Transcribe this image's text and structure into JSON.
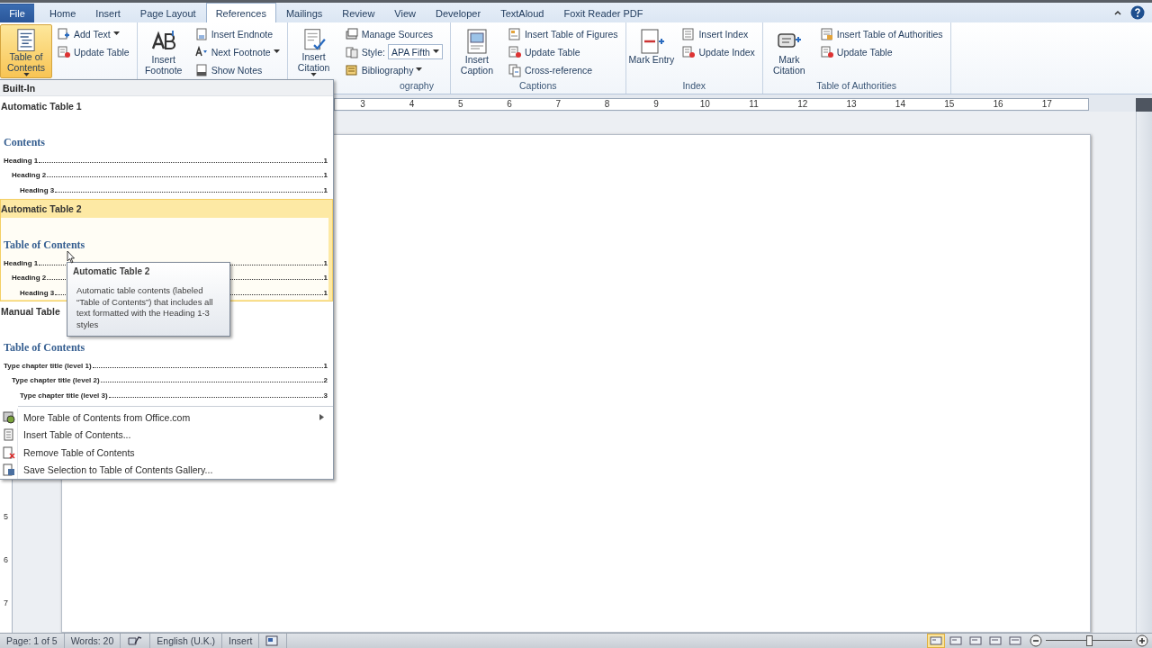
{
  "tabs": [
    {
      "label": "File",
      "kind": "file",
      "selected": false
    },
    {
      "label": "Home",
      "selected": false
    },
    {
      "label": "Insert",
      "selected": false
    },
    {
      "label": "Page Layout",
      "selected": false
    },
    {
      "label": "References",
      "selected": true
    },
    {
      "label": "Mailings",
      "selected": false
    },
    {
      "label": "Review",
      "selected": false
    },
    {
      "label": "View",
      "selected": false
    },
    {
      "label": "Developer",
      "selected": false
    },
    {
      "label": "TextAloud",
      "selected": false
    },
    {
      "label": "Foxit Reader PDF",
      "selected": false
    }
  ],
  "ribbon_groups": [
    {
      "large": {
        "label": "Table of Contents",
        "dropdown": true,
        "expanded": true
      },
      "small": [
        {
          "label": "Add Text",
          "dropdown": true
        },
        {
          "label": "Update Table"
        }
      ]
    },
    {
      "large": {
        "label": "Insert Footnote",
        "expanded": false
      },
      "small": [
        {
          "label": "Insert Endnote"
        },
        {
          "label": "Next Footnote",
          "dropdown": true
        },
        {
          "label": "Show Notes"
        }
      ]
    },
    {
      "label": "ography",
      "large": {
        "label": "Insert Citation",
        "dropdown": true,
        "expanded": false
      },
      "small": [
        {
          "label": "Manage Sources"
        },
        {
          "label": "Style:",
          "kind": "combo",
          "value": "APA Fifth"
        },
        {
          "label": "Bibliography",
          "dropdown": true
        }
      ]
    },
    {
      "label": "Captions",
      "large": {
        "label": "Insert Caption",
        "expanded": false
      },
      "small": [
        {
          "label": "Insert Table of Figures"
        },
        {
          "label": "Update Table"
        },
        {
          "label": "Cross-reference"
        }
      ]
    },
    {
      "label": "Index",
      "large": {
        "label": "Mark Entry",
        "expanded": false
      },
      "small": [
        {
          "label": "Insert Index"
        },
        {
          "label": "Update Index"
        }
      ]
    },
    {
      "label": "Table of Authorities",
      "large": {
        "label": "Mark Citation",
        "expanded": false
      },
      "small": [
        {
          "label": "Insert Table of Authorities"
        },
        {
          "label": "Update Table"
        }
      ]
    }
  ],
  "ruler_numbers": [
    "3",
    "4",
    "5",
    "6",
    "7",
    "8",
    "9",
    "10",
    "11",
    "12",
    "13",
    "14",
    "15",
    "16",
    "17"
  ],
  "vertical_ruler_numbers": [
    "5",
    "6",
    "7"
  ],
  "toc_gallery": {
    "section": "Built-In",
    "items": [
      {
        "title": "Automatic Table 1",
        "selected": false,
        "heading": "Contents",
        "entries": [
          {
            "text": "Heading 1",
            "page": "1",
            "children": [
              {
                "text": "Heading 2",
                "page": "1",
                "children": [
                  {
                    "text": "Heading 3",
                    "page": "1"
                  }
                ]
              }
            ]
          }
        ]
      },
      {
        "title": "Automatic Table 2",
        "selected": true,
        "heading": "Table of Contents",
        "entries": [
          {
            "text": "Heading 1",
            "page": "1",
            "children": [
              {
                "text": "Heading 2",
                "page": "1",
                "children": [
                  {
                    "text": "Heading 3",
                    "page": "1"
                  }
                ]
              }
            ]
          }
        ]
      },
      {
        "title": "Manual Table",
        "selected": false,
        "heading": "Table of Contents",
        "entries": [
          {
            "text": "Type chapter title (level 1)",
            "page": "1",
            "children": [
              {
                "text": "Type chapter title (level 2)",
                "page": "2",
                "children": [
                  {
                    "text": "Type chapter title (level 3)",
                    "page": "3"
                  }
                ]
              }
            ]
          }
        ]
      }
    ],
    "commands": [
      {
        "label": "More Table of Contents from Office.com",
        "submenu": true
      },
      {
        "label": "Insert Table of Contents..."
      },
      {
        "label": "Remove Table of Contents"
      },
      {
        "label": "Save Selection to Table of Contents Gallery..."
      }
    ]
  },
  "tooltip": {
    "title": "Automatic Table 2",
    "text": "Automatic table contents (labeled “Table of Contents”) that includes all text formatted with the Heading 1-3 styles"
  },
  "status_bar": {
    "items": [
      {
        "kind": "text",
        "text": "Page: 1 of 5"
      },
      {
        "kind": "text",
        "text": "Words: 20"
      },
      {
        "kind": "proofing"
      },
      {
        "kind": "text",
        "text": "English (U.K.)"
      },
      {
        "kind": "text",
        "text": "Insert"
      },
      {
        "kind": "macro"
      }
    ],
    "zoom": {
      "level": 0.5
    }
  }
}
